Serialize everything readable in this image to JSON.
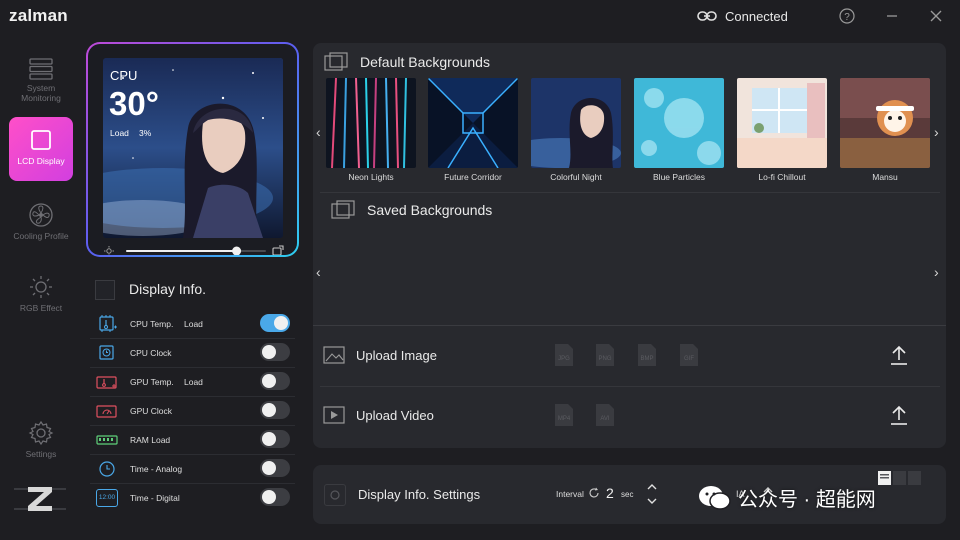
{
  "app": {
    "logo": "zalman"
  },
  "titlebar": {
    "connection_status": "Connected"
  },
  "sidebar": {
    "items": [
      {
        "id": "system-monitoring",
        "label": "System Monitoring",
        "active": false
      },
      {
        "id": "lcd-display",
        "label": "LCD Display",
        "active": true
      },
      {
        "id": "cooling-profile",
        "label": "Cooling Profile",
        "active": false
      },
      {
        "id": "rgb-effect",
        "label": "RGB Effect",
        "active": false
      },
      {
        "id": "settings",
        "label": "Settings",
        "active": false
      }
    ]
  },
  "preview": {
    "sensor": "CPU",
    "temperature": "30°",
    "load_label": "Load",
    "load_value": "3%",
    "brightness": 0.79
  },
  "display_info": {
    "title": "Display Info.",
    "rows": [
      {
        "label": "CPU Temp.",
        "sub": "Load",
        "icon": "cpu-temp-icon",
        "enabled": true
      },
      {
        "label": "CPU Clock",
        "sub": "",
        "icon": "cpu-clock-icon",
        "enabled": false
      },
      {
        "label": "GPU Temp.",
        "sub": "Load",
        "icon": "gpu-temp-icon",
        "enabled": false
      },
      {
        "label": "GPU Clock",
        "sub": "",
        "icon": "gpu-clock-icon",
        "enabled": false
      },
      {
        "label": "RAM Load",
        "sub": "",
        "icon": "ram-icon",
        "enabled": false
      },
      {
        "label": "Time - Analog",
        "sub": "",
        "icon": "clock-icon",
        "enabled": false
      },
      {
        "label": "Time - Digital",
        "sub": "",
        "icon": "digital-clock-icon",
        "icon_text": "12:00",
        "enabled": false
      }
    ]
  },
  "backgrounds": {
    "default_title": "Default Backgrounds",
    "saved_title": "Saved Backgrounds",
    "items": [
      {
        "label": "Neon Lights"
      },
      {
        "label": "Future Corridor"
      },
      {
        "label": "Colorful Night"
      },
      {
        "label": "Blue Particles"
      },
      {
        "label": "Lo-fi Chillout"
      },
      {
        "label": "Mansu"
      }
    ]
  },
  "upload": {
    "image_label": "Upload Image",
    "video_label": "Upload Video",
    "image_formats": [
      "JPG",
      "PNG",
      "BMP",
      "GIF"
    ],
    "video_formats": [
      "MP4",
      "AVI"
    ]
  },
  "bottom": {
    "title": "Display Info. Settings",
    "interval_label": "Interval",
    "interval_value": "2",
    "interval_unit": "sec",
    "extra_label": "IA"
  },
  "watermark": {
    "text": "公众号 · 超能网"
  },
  "colors": {
    "accent": "#d23fe0",
    "toggle_on": "#4aa8e8",
    "panel": "#28292e",
    "background": "#1e1e22"
  }
}
